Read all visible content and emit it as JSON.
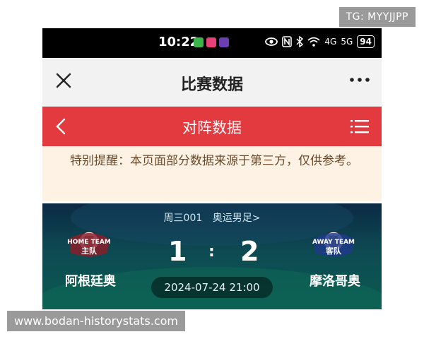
{
  "watermark_top": "TG: MYYJJPP",
  "watermark_bottom": "www.bodan-historystats.com",
  "status_bar": {
    "time": "10:22",
    "signal1": "4G",
    "signal2": "5G",
    "battery": "94"
  },
  "header": {
    "title": "比赛数据"
  },
  "subheader": {
    "title": "对阵数据"
  },
  "notice": {
    "text": "特别提醒：本页面部分数据来源于第三方，仅供参考。"
  },
  "match": {
    "match_code": "周三001",
    "league": "奥运男足>",
    "home_team": "阿根廷奥",
    "away_team": "摩洛哥奥",
    "home_badge": "HOME TEAM",
    "home_badge_sub": "主队",
    "away_badge": "AWAY TEAM",
    "away_badge_sub": "客队",
    "home_score": "1",
    "separator": ":",
    "away_score": "2",
    "datetime": "2024-07-24 21:00"
  },
  "colors": {
    "red_bar": "#e23a3f",
    "notice_bg": "#fdf2e4",
    "match_bg": "#0d4a52"
  }
}
